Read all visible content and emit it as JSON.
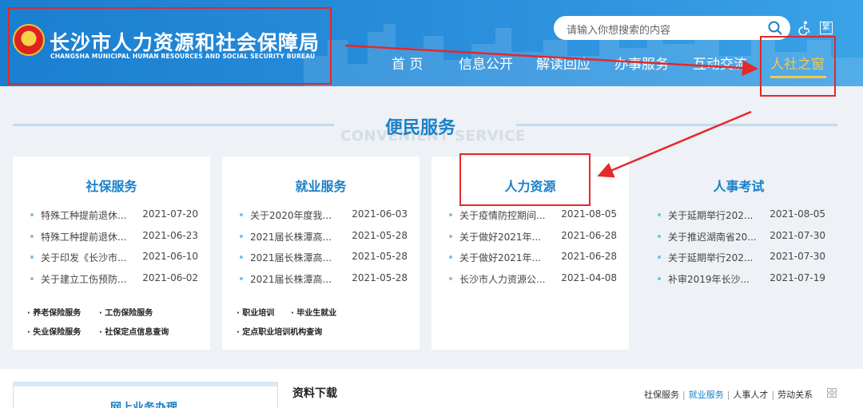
{
  "header": {
    "logo_cn": "长沙市人力资源和社会保障局",
    "logo_en": "CHANGSHA MUNICIPAL HUMAN RESOURCES AND SOCIAL SECURITY BUREAU",
    "search_placeholder": "请输入你想搜索的内容",
    "trad_label": "繁",
    "nav": [
      "首 页",
      "信息公开",
      "解读回应",
      "办事服务",
      "互动交流",
      "人社之窗"
    ]
  },
  "section": {
    "title_cn": "便民服务",
    "title_en": "CONVENIENT SERVICE"
  },
  "cards": [
    {
      "title": "社保服务",
      "rows": [
        {
          "t": "特殊工种提前退休...",
          "d": "2021-07-20"
        },
        {
          "t": "特殊工种提前退休...",
          "d": "2021-06-23"
        },
        {
          "t": "关于印发《长沙市...",
          "d": "2021-06-10"
        },
        {
          "t": "关于建立工伤预防...",
          "d": "2021-06-02"
        }
      ],
      "links": [
        "· 养老保险服务",
        "· 工伤保险服务",
        "· 失业保险服务",
        "· 社保定点信息查询"
      ]
    },
    {
      "title": "就业服务",
      "rows": [
        {
          "t": "关于2020年度我...",
          "d": "2021-06-03"
        },
        {
          "t": "2021届长株潭高...",
          "d": "2021-05-28"
        },
        {
          "t": "2021届长株潭高...",
          "d": "2021-05-28"
        },
        {
          "t": "2021届长株潭高...",
          "d": "2021-05-28"
        }
      ],
      "links": [
        "· 职业培训",
        "· 毕业生就业",
        "· 定点职业培训机构查询"
      ]
    },
    {
      "title": "人力资源",
      "rows": [
        {
          "t": "关于疫情防控期间...",
          "d": "2021-08-05"
        },
        {
          "t": "关于做好2021年...",
          "d": "2021-06-28"
        },
        {
          "t": "关于做好2021年...",
          "d": "2021-06-28"
        },
        {
          "t": "长沙市人力资源公...",
          "d": "2021-04-08"
        }
      ],
      "links": []
    },
    {
      "title": "人事考试",
      "rows": [
        {
          "t": "关于延期举行202...",
          "d": "2021-08-05"
        },
        {
          "t": "关于推迟湖南省20...",
          "d": "2021-07-30"
        },
        {
          "t": "关于延期举行202...",
          "d": "2021-07-30"
        },
        {
          "t": "补审2019年长沙...",
          "d": "2021-07-19"
        }
      ],
      "links": []
    }
  ],
  "bottom": {
    "online_title": "网上业务办理",
    "download_title": "资料下载",
    "tabs": [
      "社保服务",
      "就业服务",
      "人事人才",
      "劳动关系"
    ]
  },
  "colors": {
    "header_blue": "#1a7fd0",
    "accent_blue": "#1a80c8",
    "highlight_red": "#e52828",
    "nav_active": "#f5c84a"
  }
}
